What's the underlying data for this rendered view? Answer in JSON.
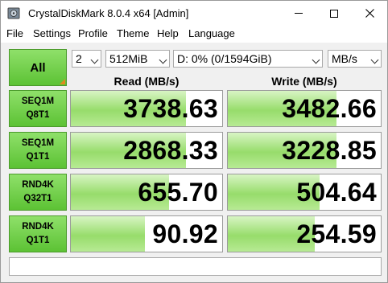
{
  "window": {
    "title": "CrystalDiskMark 8.0.4 x64 [Admin]"
  },
  "menu": [
    "File",
    "Settings",
    "Profile",
    "Theme",
    "Help",
    "Language"
  ],
  "controls": {
    "all_label": "All",
    "count": "2",
    "size": "512MiB",
    "drive": "D: 0% (0/1594GiB)",
    "unit": "MB/s"
  },
  "headers": {
    "read": "Read (MB/s)",
    "write": "Write (MB/s)"
  },
  "tests": [
    {
      "line1": "SEQ1M",
      "line2": "Q8T1",
      "read": "3738.63",
      "write": "3482.66",
      "read_fill": 0.76,
      "write_fill": 0.71
    },
    {
      "line1": "SEQ1M",
      "line2": "Q1T1",
      "read": "2868.33",
      "write": "3228.85",
      "read_fill": 0.76,
      "write_fill": 0.71
    },
    {
      "line1": "RND4K",
      "line2": "Q32T1",
      "read": "655.70",
      "write": "504.64",
      "read_fill": 0.65,
      "write_fill": 0.6
    },
    {
      "line1": "RND4K",
      "line2": "Q1T1",
      "read": "90.92",
      "write": "254.59",
      "read_fill": 0.49,
      "write_fill": 0.57
    }
  ],
  "comment": ""
}
